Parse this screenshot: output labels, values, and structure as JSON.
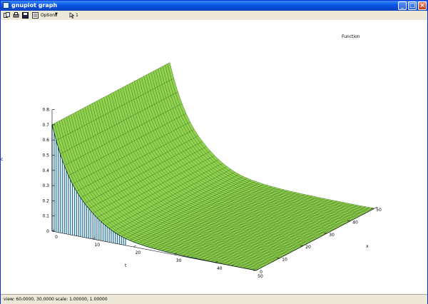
{
  "window": {
    "title": "gnuplot graph",
    "buttons": [
      "minimize",
      "maximize",
      "close"
    ]
  },
  "toolbar": {
    "options_label": "Options",
    "mouse_label": "1"
  },
  "plot": {
    "key_label": "Function",
    "z_axis_label": "c",
    "t_axis_label": "t",
    "x_axis_label": "x",
    "z_ticks": [
      "0",
      "0.1",
      "0.2",
      "0.3",
      "0.4",
      "0.5",
      "0.6",
      "0.7",
      "0.8"
    ],
    "t_ticks": [
      "0",
      "10",
      "20",
      "30",
      "40",
      "50"
    ],
    "x_ticks": [
      "0",
      "10",
      "20",
      "30",
      "40",
      "50"
    ],
    "colors": {
      "surface_top": "#8fd24d",
      "surface_side": "#4fc3d9",
      "mesh": "#000000"
    }
  },
  "status": {
    "text": "view: 60.0000, 30.0000   scale: 1.00000, 1.00000"
  }
}
